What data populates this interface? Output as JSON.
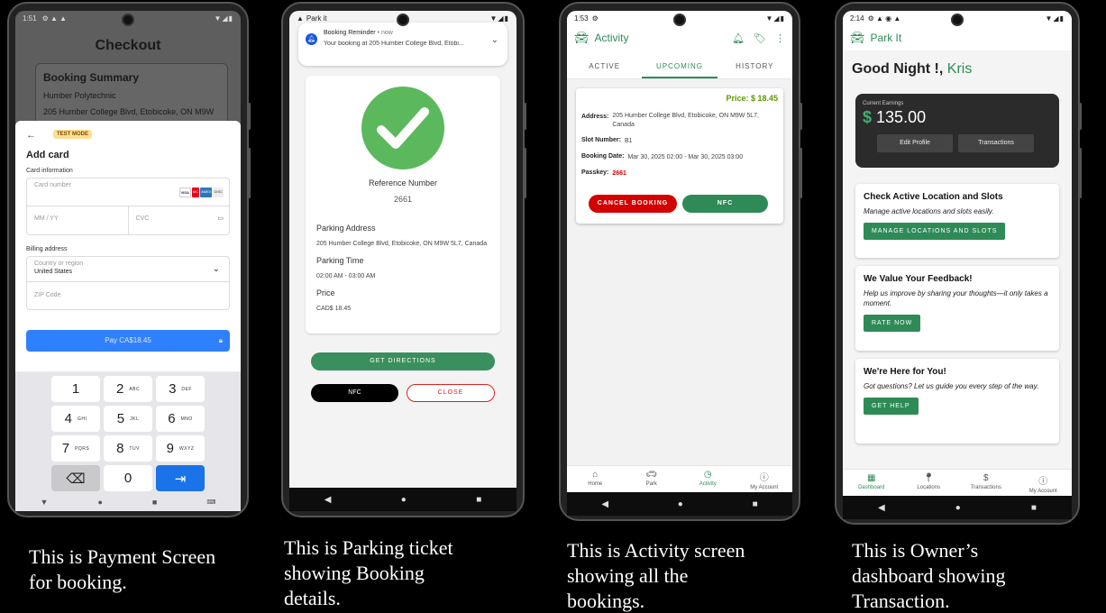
{
  "screens": {
    "payment": {
      "status_time": "1:51",
      "title": "Checkout",
      "summary_title": "Booking Summary",
      "summary_line1": "Humber Polytechnic",
      "summary_line2": "205 Humber College Blvd, Etobicoke, ON M9W",
      "back_glyph": "←",
      "test_mode": "TEST MODE",
      "add_card": "Add card",
      "card_information": "Card information",
      "card_number_placeholder": "Card number",
      "expiry_placeholder": "MM / YY",
      "cvc_placeholder": "CVC",
      "billing_address": "Billing address",
      "country_label": "Country or region",
      "country_value": "United States",
      "zip_placeholder": "ZIP Code",
      "pay_label": "Pay CA$18.45",
      "card_brands": [
        "VISA",
        "MC",
        "AMEX",
        "DISC"
      ],
      "keys": [
        {
          "n": "1",
          "s": ""
        },
        {
          "n": "2",
          "s": "ABC"
        },
        {
          "n": "3",
          "s": "DEF"
        },
        {
          "n": "4",
          "s": "GHI"
        },
        {
          "n": "5",
          "s": "JKL"
        },
        {
          "n": "6",
          "s": "MNO"
        },
        {
          "n": "7",
          "s": "PQRS"
        },
        {
          "n": "8",
          "s": "TUV"
        },
        {
          "n": "9",
          "s": "WXYZ"
        },
        {
          "n": "⌫",
          "s": ""
        },
        {
          "n": "0",
          "s": ""
        },
        {
          "n": "⇥",
          "s": ""
        }
      ],
      "caption": "This is Payment Screen\nfor booking."
    },
    "ticket": {
      "status_app": "Park it",
      "notif_title": "Booking Reminder",
      "notif_time": "• now",
      "notif_body": "Your booking at 205 Humber College Blvd, Etobi...",
      "ref_label": "Reference Number",
      "ref_value": "2661",
      "addr_label": "Parking Address",
      "addr_value": "205 Humber College Blvd, Etobicoke, ON M9W 5L7, Canada",
      "time_label": "Parking Time",
      "time_value": "02:00 AM - 03:00 AM",
      "price_label": "Price",
      "price_value": "CAD$ 18.45",
      "directions_btn": "GET DIRECTIONS",
      "nfc_btn": "NFC",
      "close_btn": "CLOSE",
      "caption": "This is Parking ticket\nshowing Booking\ndetails."
    },
    "activity": {
      "status_time": "1:53",
      "title": "Activity",
      "tabs": [
        "ACTIVE",
        "UPCOMING",
        "HISTORY"
      ],
      "price": "Price:  $ 18.45",
      "address_k": "Address:",
      "address_v": "205 Humber College Blvd, Etobicoke, ON M9W 5L7, Canada",
      "slot_k": "Slot Number:",
      "slot_v": "B1",
      "date_k": "Booking Date:",
      "date_v": "Mar 30, 2025 02:00 - Mar 30, 2025 03:00",
      "pass_k": "Passkey:",
      "pass_v": "2661",
      "cancel_btn": "CANCEL BOOKING",
      "nfc_btn": "NFC",
      "nav": [
        "Home",
        "Park",
        "Activity",
        "My Account"
      ],
      "caption": "This is Activity screen\nshowing all the\nbookings."
    },
    "owner": {
      "status_time": "2:14",
      "title": "Park It",
      "greeting": "Good Night !,",
      "name": "Kris",
      "earn_label": "Current Earnings",
      "earn_currency": "$",
      "earn_value": "135.00",
      "edit_btn": "Edit Profile",
      "tx_btn": "Transactions",
      "card1_h": "Check Active Location and Slots",
      "card1_s": "Manage active locations and slots easily.",
      "card1_b": "MANAGE LOCATIONS AND SLOTS",
      "card2_h": "We Value Your Feedback!",
      "card2_s": "Help us improve by sharing your thoughts—it only takes a moment.",
      "card2_b": "RATE NOW",
      "card3_h": "We're Here for You!",
      "card3_s": "Got questions? Let us guide you every step of the way.",
      "card3_b": "GET HELP",
      "nav": [
        "Dashboard",
        "Locations",
        "Transactions",
        "My Account"
      ],
      "caption": "This is Owner’s\ndashboard showing\nTransaction."
    }
  },
  "colors": {
    "brand_green": "#2e8b57",
    "danger_red": "#d40000",
    "pay_blue": "#2f80ff"
  }
}
